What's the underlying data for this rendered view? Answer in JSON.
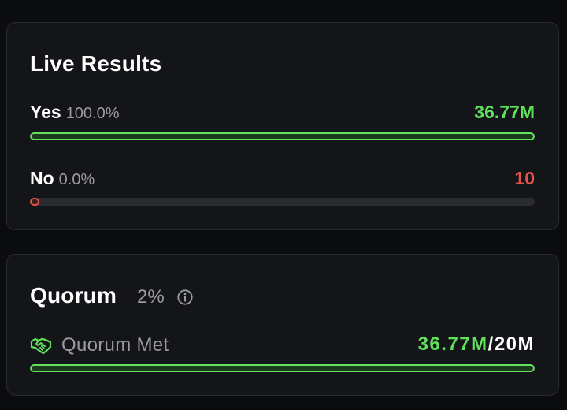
{
  "live_results": {
    "title": "Live Results",
    "options": [
      {
        "name": "Yes",
        "percent": "100.0%",
        "votes": "36.77M",
        "fill_fraction": 1.0,
        "color": "#5ee05a"
      },
      {
        "name": "No",
        "percent": "0.0%",
        "votes": "10",
        "fill_fraction": 0.0,
        "color": "#e5534b"
      }
    ]
  },
  "quorum": {
    "title": "Quorum",
    "percent": "2%",
    "info_icon": "info-icon",
    "status_icon": "handshake-icon",
    "status_label": "Quorum Met",
    "current": "36.77M",
    "separator": "/",
    "target": "20M",
    "fill_fraction": 1.0
  },
  "colors": {
    "accent_green": "#5ee05a",
    "accent_red": "#e5534b",
    "background": "#0b0c0e",
    "card": "#141518"
  }
}
